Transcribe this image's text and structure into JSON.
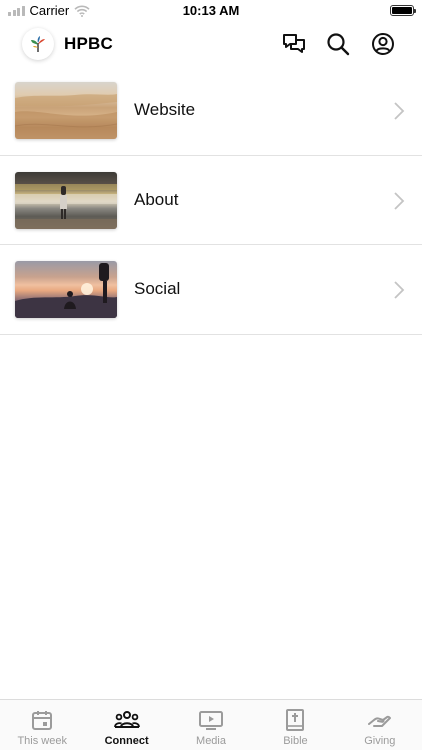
{
  "status_bar": {
    "carrier": "Carrier",
    "time": "10:13 AM"
  },
  "header": {
    "title": "HPBC",
    "icons": [
      "chat-icon",
      "search-icon",
      "profile-icon"
    ]
  },
  "list": {
    "items": [
      {
        "label": "Website",
        "thumbnail": "desert-dunes-photo"
      },
      {
        "label": "About",
        "thumbnail": "train-platform-photo"
      },
      {
        "label": "Social",
        "thumbnail": "sunset-people-photo"
      }
    ]
  },
  "tab_bar": {
    "tabs": [
      {
        "label": "This week",
        "icon": "calendar-icon",
        "active": false
      },
      {
        "label": "Connect",
        "icon": "people-icon",
        "active": true
      },
      {
        "label": "Media",
        "icon": "play-icon",
        "active": false
      },
      {
        "label": "Bible",
        "icon": "bible-icon",
        "active": false
      },
      {
        "label": "Giving",
        "icon": "giving-hand-icon",
        "active": false
      }
    ]
  },
  "colors": {
    "active": "#111111",
    "inactive": "#9b9b9b",
    "divider": "#e2e2e2"
  }
}
